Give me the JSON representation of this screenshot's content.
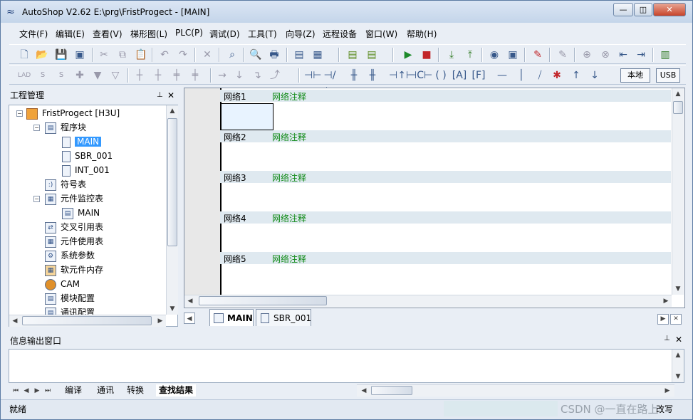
{
  "window": {
    "title": "AutoShop V2.62  E:\\prg\\FristProgect - [MAIN]",
    "buttons": {
      "minimize": "—",
      "restore": "◫",
      "close": "✕"
    }
  },
  "menu": [
    "文件(F)",
    "编辑(E)",
    "查看(V)",
    "梯形图(L)",
    "PLC(P)",
    "调试(D)",
    "工具(T)",
    "向导(Z)",
    "远程设备",
    "窗口(W)",
    "帮助(H)"
  ],
  "toolbar2": {
    "local": "本地",
    "usb": "USB"
  },
  "project_panel": {
    "title": "工程管理",
    "pin": "ᵖ",
    "close": "✕",
    "tree": {
      "root": "FristProgect [H3U]",
      "program_blocks": "程序块",
      "main": "MAIN",
      "sbr": "SBR_001",
      "int": "INT_001",
      "symbol_table": "符号表",
      "monitor_table": "元件监控表",
      "monitor_main": "MAIN",
      "cross_ref": "交叉引用表",
      "usage_table": "元件使用表",
      "sys_params": "系统参数",
      "soft_memory": "软元件内存",
      "cam": "CAM",
      "module_config": "模块配置",
      "comm_config": "通讯配置"
    }
  },
  "networks": [
    {
      "label": "网络1",
      "comment": "网络注释"
    },
    {
      "label": "网络2",
      "comment": "网络注释"
    },
    {
      "label": "网络3",
      "comment": "网络注释"
    },
    {
      "label": "网络4",
      "comment": "网络注释"
    },
    {
      "label": "网络5",
      "comment": "网络注释"
    }
  ],
  "editor_tabs": {
    "main": "MAIN",
    "sbr": "SBR_001"
  },
  "output": {
    "title": "信息输出窗口",
    "tabs": [
      "编译",
      "通讯",
      "转换",
      "查找结果"
    ]
  },
  "status": {
    "left": "就绪",
    "right": "改写",
    "watermark": "CSDN @一直在路上"
  }
}
